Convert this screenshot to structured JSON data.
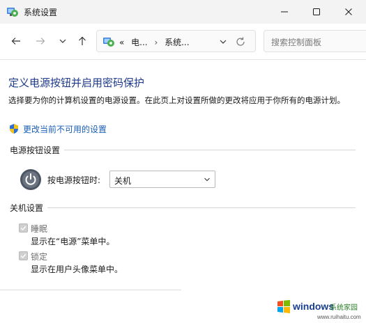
{
  "window": {
    "title": "系统设置"
  },
  "address_bar": {
    "breadcrumbs": [
      "电...",
      "系统..."
    ],
    "prefix": "«"
  },
  "search": {
    "placeholder": "搜索控制面板"
  },
  "content": {
    "title": "定义电源按钮并启用密码保护",
    "description": "选择要为你的计算机设置的电源设置。在此页上对设置所做的更改将应用于你所有的电源计划。",
    "uac_link": "更改当前不可用的设置"
  },
  "power_buttons": {
    "section_title": "电源按钮设置",
    "label": "按电源按钮时:",
    "selected": "关机"
  },
  "shutdown": {
    "section_title": "关机设置",
    "options": [
      {
        "label": "睡眠",
        "detail": "显示在“电源”菜单中。",
        "checked": true,
        "enabled": false
      },
      {
        "label": "锁定",
        "detail": "显示在用户头像菜单中。",
        "checked": true,
        "enabled": false
      }
    ]
  },
  "watermark": {
    "brand_part1": "windows",
    "brand_part2": "系统家园",
    "url": "www.ruihaitu.com"
  },
  "colors": {
    "title_blue": "#1e3a8a",
    "link_blue": "#1a5fb4",
    "titlebar_bg": "#f3f3f3"
  }
}
